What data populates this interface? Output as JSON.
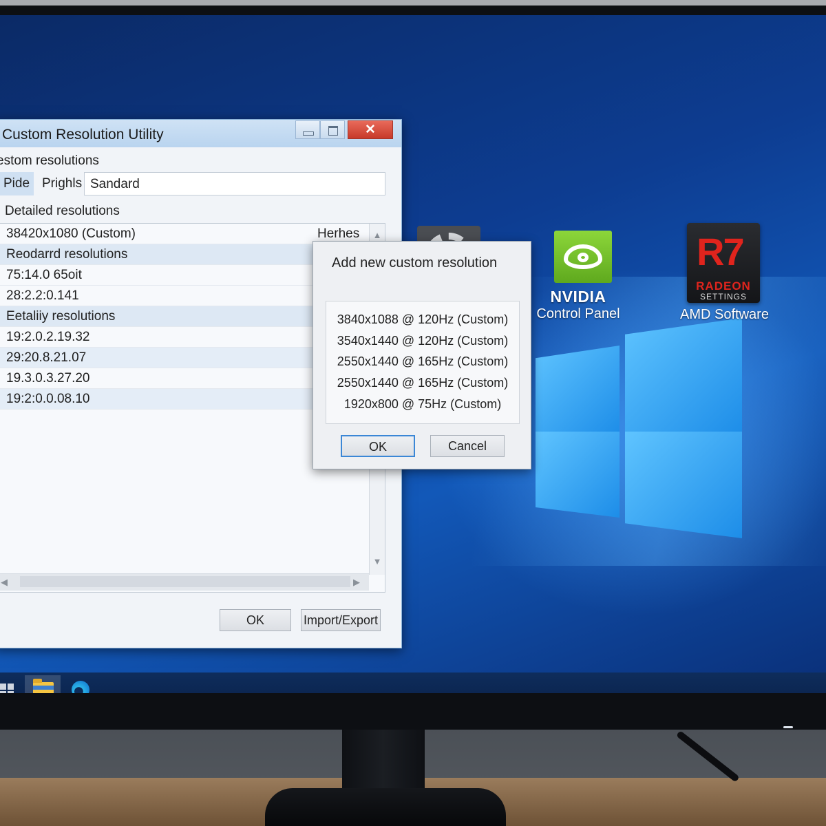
{
  "window": {
    "title": "Custom Resolution Utility",
    "section_label": "estom resolutions",
    "tabs": [
      "Pide",
      "Prighls",
      "Sandard"
    ],
    "detailed_label": "Detailed resolutions",
    "rows": [
      {
        "text": "38420x1080 (Custom)",
        "type": "item",
        "extra": "Herhes"
      },
      {
        "text": "Reodarrd resolutions",
        "type": "group"
      },
      {
        "text": "75:14.0 65oit",
        "type": "item"
      },
      {
        "text": "28:2.2:0.141",
        "type": "item"
      },
      {
        "text": "Eetaliiy resolutions",
        "type": "group"
      },
      {
        "text": "19:2.0.2.19.32",
        "type": "item"
      },
      {
        "text": "29:20.8.21.07",
        "type": "alt"
      },
      {
        "text": "19.3.0.3.27.20",
        "type": "item"
      },
      {
        "text": "19:2:0.0.08.10",
        "type": "alt"
      }
    ],
    "ok_label": "OK",
    "import_export_label": "Import/Export",
    "close_glyph": "✕"
  },
  "dialog": {
    "title": "Add new custom resolution",
    "items": [
      "3840x1088 @ 120Hz (Custom)",
      "3540x1440 @ 120Hz (Custom)",
      "2550x1440 @ 165Hz (Custom)",
      "2550x1440 @ 165Hz (Custom)",
      "1920x800 @ 75Hz (Custom)"
    ],
    "ok_label": "OK",
    "cancel_label": "Cancel"
  },
  "desktop": {
    "nvidia_brand": "NVIDIA",
    "nvidia_label": "Control Panel",
    "amd_mark": "R7",
    "amd_radeon": "RADEON",
    "amd_settings": "SETTINGS",
    "amd_label": "AMD Software"
  },
  "taskbar": {
    "icons": [
      "windows-start-icon",
      "file-explorer-icon",
      "edge-browser-icon"
    ]
  },
  "colors": {
    "desktop_blue": "#0d3d92",
    "nvidia_green": "#76b900",
    "amd_red": "#e0241d",
    "close_red": "#c7392a",
    "selection_blue": "#dde8f4"
  }
}
